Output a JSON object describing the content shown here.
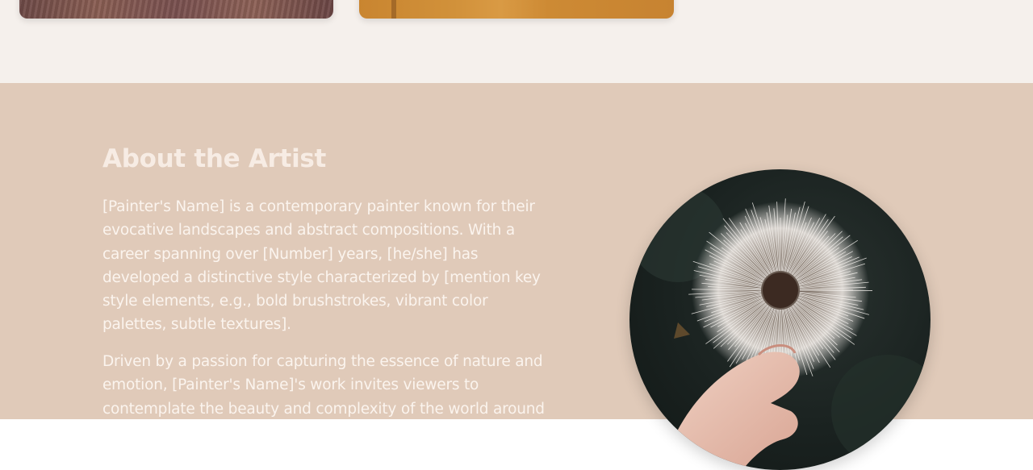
{
  "about": {
    "title": "About the Artist",
    "paragraphs": [
      "[Painter's Name] is a contemporary painter known for their evocative landscapes and abstract compositions. With a career spanning over [Number] years, [he/she] has developed a distinctive style characterized by [mention key style elements, e.g., bold brushstrokes, vibrant color palettes, subtle textures].",
      "Driven by a passion for capturing the essence of nature and emotion, [Painter's Name]'s work invites viewers to contemplate the beauty and complexity of the world around"
    ]
  },
  "colors": {
    "gallery_background": "#f5f0ec",
    "about_background": "#e0cab9",
    "text_light": "#fbf4ee"
  }
}
